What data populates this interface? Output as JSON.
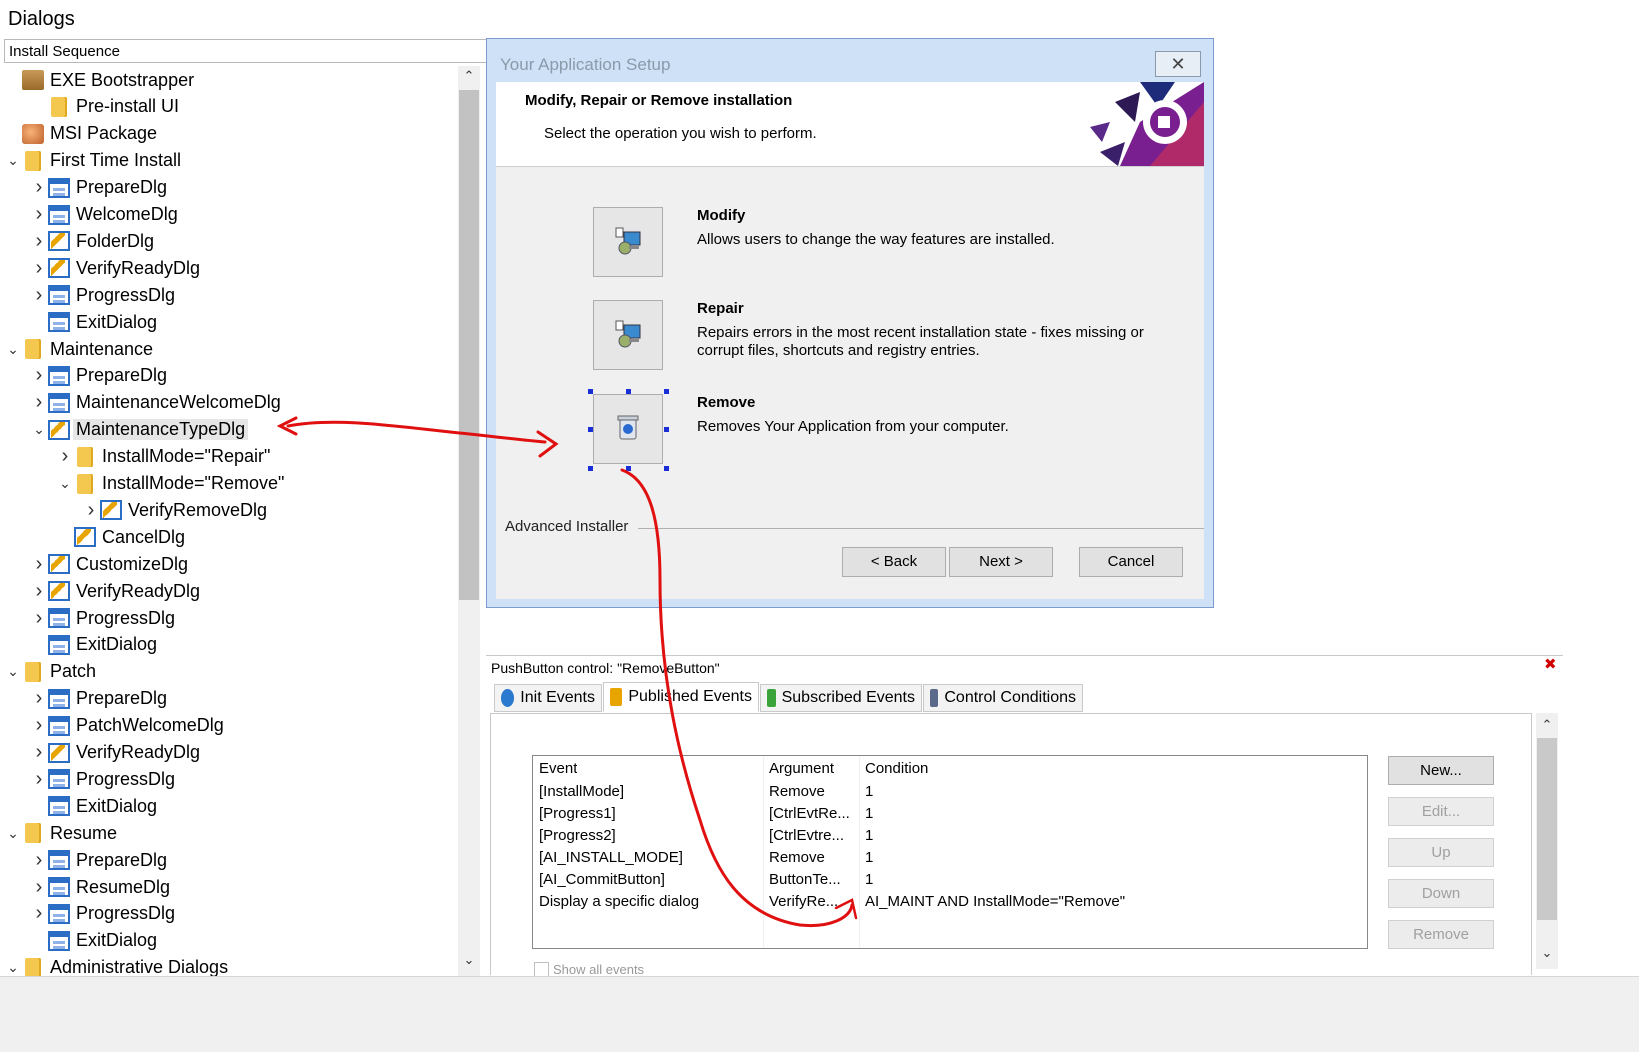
{
  "page_title": "Dialogs",
  "sequence_header": "Install Sequence",
  "tree": [
    {
      "label": "EXE Bootstrapper",
      "icon": "package-icon",
      "level": 0,
      "chevron": ""
    },
    {
      "label": "Pre-install UI",
      "icon": "folder-icon",
      "level": 1,
      "chevron": ""
    },
    {
      "label": "MSI Package",
      "icon": "msi-icon",
      "level": 0,
      "chevron": ""
    },
    {
      "label": "First Time Install",
      "icon": "folder-icon",
      "level": 0,
      "chevron": "down"
    },
    {
      "label": "PrepareDlg",
      "icon": "dialog-icon",
      "level": 1,
      "chevron": "right"
    },
    {
      "label": "WelcomeDlg",
      "icon": "dialog-icon",
      "level": 1,
      "chevron": "right"
    },
    {
      "label": "FolderDlg",
      "icon": "dialog-event-icon",
      "level": 1,
      "chevron": "right"
    },
    {
      "label": "VerifyReadyDlg",
      "icon": "dialog-event-icon",
      "level": 1,
      "chevron": "right"
    },
    {
      "label": "ProgressDlg",
      "icon": "dialog-icon",
      "level": 1,
      "chevron": "right"
    },
    {
      "label": "ExitDialog",
      "icon": "dialog-icon",
      "level": 1,
      "chevron": ""
    },
    {
      "label": "Maintenance",
      "icon": "folder-icon",
      "level": 0,
      "chevron": "down"
    },
    {
      "label": "PrepareDlg",
      "icon": "dialog-icon",
      "level": 1,
      "chevron": "right"
    },
    {
      "label": "MaintenanceWelcomeDlg",
      "icon": "dialog-icon",
      "level": 1,
      "chevron": "right"
    },
    {
      "label": "MaintenanceTypeDlg",
      "icon": "dialog-event-icon",
      "level": 1,
      "chevron": "down",
      "selected": true
    },
    {
      "label": "InstallMode=\"Repair\"",
      "icon": "folder-icon",
      "level": 2,
      "chevron": "right"
    },
    {
      "label": "InstallMode=\"Remove\"",
      "icon": "folder-icon",
      "level": 2,
      "chevron": "down"
    },
    {
      "label": "VerifyRemoveDlg",
      "icon": "dialog-event-icon",
      "level": 3,
      "chevron": "right"
    },
    {
      "label": "CancelDlg",
      "icon": "dialog-event-icon",
      "level": 2,
      "chevron": ""
    },
    {
      "label": "CustomizeDlg",
      "icon": "dialog-event-icon",
      "level": 1,
      "chevron": "right"
    },
    {
      "label": "VerifyReadyDlg",
      "icon": "dialog-event-icon",
      "level": 1,
      "chevron": "right"
    },
    {
      "label": "ProgressDlg",
      "icon": "dialog-icon",
      "level": 1,
      "chevron": "right"
    },
    {
      "label": "ExitDialog",
      "icon": "dialog-icon",
      "level": 1,
      "chevron": ""
    },
    {
      "label": "Patch",
      "icon": "folder-icon",
      "level": 0,
      "chevron": "down"
    },
    {
      "label": "PrepareDlg",
      "icon": "dialog-icon",
      "level": 1,
      "chevron": "right"
    },
    {
      "label": "PatchWelcomeDlg",
      "icon": "dialog-icon",
      "level": 1,
      "chevron": "right"
    },
    {
      "label": "VerifyReadyDlg",
      "icon": "dialog-event-icon",
      "level": 1,
      "chevron": "right"
    },
    {
      "label": "ProgressDlg",
      "icon": "dialog-icon",
      "level": 1,
      "chevron": "right"
    },
    {
      "label": "ExitDialog",
      "icon": "dialog-icon",
      "level": 1,
      "chevron": ""
    },
    {
      "label": "Resume",
      "icon": "folder-icon",
      "level": 0,
      "chevron": "down"
    },
    {
      "label": "PrepareDlg",
      "icon": "dialog-icon",
      "level": 1,
      "chevron": "right"
    },
    {
      "label": "ResumeDlg",
      "icon": "dialog-icon",
      "level": 1,
      "chevron": "right"
    },
    {
      "label": "ProgressDlg",
      "icon": "dialog-icon",
      "level": 1,
      "chevron": "right"
    },
    {
      "label": "ExitDialog",
      "icon": "dialog-icon",
      "level": 1,
      "chevron": ""
    },
    {
      "label": "Administrative Dialogs",
      "icon": "folder-icon",
      "level": 0,
      "chevron": "down"
    }
  ],
  "dialog": {
    "title": "Your Application Setup",
    "heading": "Modify, Repair or Remove installation",
    "subheading": "Select the operation you wish to perform.",
    "options": [
      {
        "title": "Modify",
        "description": "Allows users to change the way features are installed.",
        "icon": "modify-icon"
      },
      {
        "title": "Repair",
        "description": "Repairs errors in the most recent installation state - fixes missing or corrupt files, shortcuts and registry entries.",
        "icon": "repair-icon"
      },
      {
        "title": "Remove",
        "description": "Removes Your Application from your computer.",
        "icon": "remove-icon",
        "selected": true
      }
    ],
    "footer_label": "Advanced Installer",
    "back_label": "< Back",
    "next_label": "Next >",
    "cancel_label": "Cancel"
  },
  "properties": {
    "header": "PushButton control: \"RemoveButton\"",
    "tabs": [
      {
        "label": "Init Events",
        "icon": "gear-icon"
      },
      {
        "label": "Published Events",
        "icon": "lightning-icon",
        "active": true
      },
      {
        "label": "Subscribed Events",
        "icon": "chart-icon"
      },
      {
        "label": "Control Conditions",
        "icon": "conditions-icon"
      }
    ],
    "columns": [
      "Event",
      "Argument",
      "Condition"
    ],
    "rows": [
      [
        "[InstallMode]",
        "Remove",
        "1"
      ],
      [
        "[Progress1]",
        "[CtrlEvtRe...",
        "1"
      ],
      [
        "[Progress2]",
        "[CtrlEvtre...",
        "1"
      ],
      [
        "[AI_INSTALL_MODE]",
        "Remove",
        "1"
      ],
      [
        "[AI_CommitButton]",
        "ButtonTe...",
        "1"
      ],
      [
        "Display a specific dialog",
        "VerifyRe...",
        "AI_MAINT AND InstallMode=\"Remove\""
      ]
    ],
    "buttons": {
      "new": "New...",
      "edit": "Edit...",
      "up": "Up",
      "down": "Down",
      "remove": "Remove"
    },
    "show_all": "Show all events"
  },
  "colors": {
    "annotation": "#e01010",
    "selection_handle": "#1a2ed8",
    "dialog_border": "#7a9bcf"
  }
}
